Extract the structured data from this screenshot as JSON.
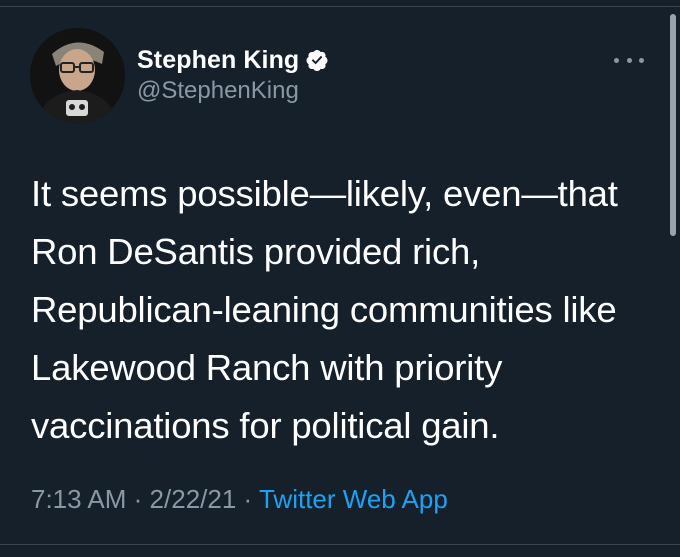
{
  "tweet": {
    "author": {
      "display_name": "Stephen King",
      "handle": "@StephenKing",
      "verified_icon": "verified-badge-icon"
    },
    "more_icon": "more-options-icon",
    "text": "It seems possible—likely, even—that Ron DeSantis provided rich, Republican-leaning communities like Lakewood Ranch with priority vaccinations for political gain.",
    "time": "7:13 AM",
    "separator": "·",
    "date": "2/22/21",
    "source": "Twitter Web App"
  },
  "colors": {
    "background": "#15202b",
    "primary_text": "#ffffff",
    "secondary_text": "#8899a6",
    "accent": "#1da1f2"
  }
}
